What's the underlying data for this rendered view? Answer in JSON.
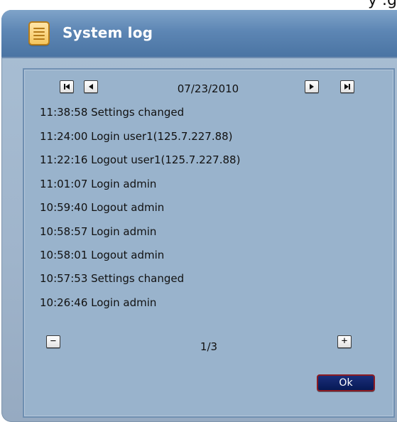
{
  "top_fragment": "y .g",
  "dialog": {
    "title": "System log",
    "icon": "notepad-icon",
    "accent": "#4a74a3"
  },
  "navigation": {
    "date": "07/23/2010",
    "first_icon": "first-page-icon",
    "prev_icon": "prev-page-icon",
    "next_icon": "next-page-icon",
    "last_icon": "last-page-icon"
  },
  "log_entries": [
    "11:38:58 Settings changed",
    "11:24:00 Login user1(125.7.227.88)",
    "11:22:16 Logout user1(125.7.227.88)",
    "11:01:07 Login admin",
    "10:59:40 Logout admin",
    "10:58:57 Login admin",
    "10:58:01 Logout admin",
    "10:57:53 Settings changed",
    "10:26:46 Login admin"
  ],
  "pagination": {
    "minus_label": "−",
    "plus_label": "+",
    "page_info": "1/3"
  },
  "ok_label": "Ok"
}
